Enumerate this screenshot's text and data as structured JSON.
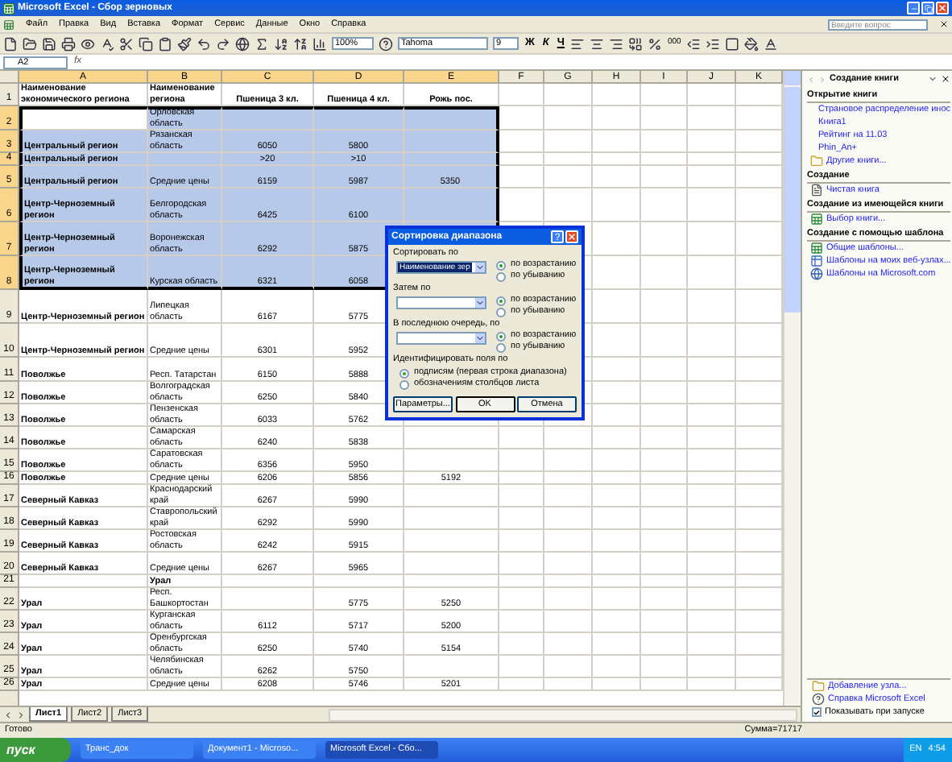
{
  "window": {
    "title": "Microsoft Excel - Сбор зерновых"
  },
  "menu": [
    "Файл",
    "Правка",
    "Вид",
    "Вставка",
    "Формат",
    "Сервис",
    "Данные",
    "Окно",
    "Справка"
  ],
  "help_search": {
    "placeholder": "Введите вопрос"
  },
  "toolbar": {
    "zoom": "100%",
    "font": "Tahoma",
    "size": "9",
    "format_buttons": [
      "Ж",
      "К",
      "Ч"
    ],
    "thousands": "000"
  },
  "formula_bar": {
    "name_box": "A2",
    "fx": "fx"
  },
  "columns": [
    {
      "label": "A",
      "selected": true
    },
    {
      "label": "B",
      "selected": true
    },
    {
      "label": "C",
      "selected": true
    },
    {
      "label": "D",
      "selected": true
    },
    {
      "label": "E",
      "selected": true
    },
    {
      "label": "F",
      "selected": false
    },
    {
      "label": "G",
      "selected": false
    },
    {
      "label": "H",
      "selected": false
    },
    {
      "label": "I",
      "selected": false
    },
    {
      "label": "J",
      "selected": false
    },
    {
      "label": "K",
      "selected": false
    }
  ],
  "rows": [
    {
      "n": "1",
      "kind": "header",
      "selected": false,
      "a": "Наименование экономического региона",
      "b": "Наименование региона",
      "c": "Пшеница 3 кл.",
      "d": "Пшеница 4 кл.",
      "e": "Рожь пос."
    },
    {
      "n": "2",
      "kind": "data",
      "selected": true,
      "b": "Орловская область"
    },
    {
      "n": "3",
      "kind": "data",
      "selected": true,
      "a": "Центральный регион",
      "b": "Рязанская область",
      "c": "6050",
      "d": "5800"
    },
    {
      "n": "4",
      "kind": "data",
      "selected": true,
      "a": "Центральный регион",
      "c": ">20",
      "d": ">10"
    },
    {
      "n": "5",
      "kind": "data",
      "selected": true,
      "a": "Центральный регион",
      "b": "Средние цены",
      "c": "6159",
      "d": "5987",
      "e": "5350"
    },
    {
      "n": "6",
      "kind": "data",
      "selected": true,
      "a": "Центр-Черноземный регион",
      "b": "Белгородская область",
      "c": "6425",
      "d": "6100"
    },
    {
      "n": "7",
      "kind": "data",
      "selected": true,
      "a": "Центр-Черноземный регион",
      "b": "Воронежская область",
      "c": "6292",
      "d": "5875"
    },
    {
      "n": "8",
      "kind": "data",
      "selected": true,
      "a": "Центр-Черноземный регион",
      "b": "Курская область",
      "c": "6321",
      "d": "6058"
    },
    {
      "n": "9",
      "kind": "data",
      "selected": false,
      "a": "Центр-Черноземный регион",
      "b": "Липецкая область",
      "c": "6167",
      "d": "5775"
    },
    {
      "n": "10",
      "kind": "data",
      "selected": false,
      "a": "Центр-Черноземный регион",
      "b": "Средние цены",
      "c": "6301",
      "d": "5952"
    },
    {
      "n": "11",
      "kind": "data",
      "selected": false,
      "a": "Поволжье",
      "b": "Респ. Татарстан",
      "c": "6150",
      "d": "5888"
    },
    {
      "n": "12",
      "kind": "data",
      "selected": false,
      "a": "Поволжье",
      "b": "Волгоградская область",
      "c": "6250",
      "d": "5840"
    },
    {
      "n": "13",
      "kind": "data",
      "selected": false,
      "a": "Поволжье",
      "b": "Пензенская область",
      "c": "6033",
      "d": "5762"
    },
    {
      "n": "14",
      "kind": "data",
      "selected": false,
      "a": "Поволжье",
      "b": "Самарская область",
      "c": "6240",
      "d": "5838"
    },
    {
      "n": "15",
      "kind": "data",
      "selected": false,
      "a": "Поволжье",
      "b": "Саратовская область",
      "c": "6356",
      "d": "5950"
    },
    {
      "n": "16",
      "kind": "data",
      "selected": false,
      "a": "Поволжье",
      "b": "Средние цены",
      "c": "6206",
      "d": "5856",
      "e": "5192"
    },
    {
      "n": "17",
      "kind": "data",
      "selected": false,
      "a": "Северный Кавказ",
      "b": "Краснодарский край",
      "c": "6267",
      "d": "5990"
    },
    {
      "n": "18",
      "kind": "data",
      "selected": false,
      "a": "Северный Кавказ",
      "b": "Ставропольский край",
      "c": "6292",
      "d": "5990"
    },
    {
      "n": "19",
      "kind": "data",
      "selected": false,
      "a": "Северный Кавказ",
      "b": "Ростовская область",
      "c": "6242",
      "d": "5915"
    },
    {
      "n": "20",
      "kind": "data",
      "selected": false,
      "a": "Северный Кавказ",
      "b": "Средние цены",
      "c": "6267",
      "d": "5965"
    },
    {
      "n": "21",
      "kind": "subheading",
      "selected": false,
      "b": "Урал"
    },
    {
      "n": "22",
      "kind": "data",
      "selected": false,
      "a": "Урал",
      "b": "Респ. Башкортостан",
      "d": "5775",
      "e": "5250"
    },
    {
      "n": "23",
      "kind": "data",
      "selected": false,
      "a": "Урал",
      "b": "Курганская область",
      "c": "6112",
      "d": "5717",
      "e": "5200"
    },
    {
      "n": "24",
      "kind": "data",
      "selected": false,
      "a": "Урал",
      "b": "Оренбургская область",
      "c": "6250",
      "d": "5740",
      "e": "5154"
    },
    {
      "n": "25",
      "kind": "data",
      "selected": false,
      "a": "Урал",
      "b": "Челябинская область",
      "c": "6262",
      "d": "5750"
    },
    {
      "n": "26",
      "kind": "data",
      "selected": false,
      "a": "Урал",
      "b": "Средние цены",
      "c": "6208",
      "d": "5746",
      "e": "5201"
    }
  ],
  "sheet_tabs": [
    {
      "label": "Лист1",
      "selected": true
    },
    {
      "label": "Лист2",
      "selected": false
    },
    {
      "label": "Лист3",
      "selected": false
    }
  ],
  "status_bar": {
    "state": "Готово",
    "sum": "Сумма=71717"
  },
  "dialog": {
    "title": "Сортировка диапазона",
    "help": "?",
    "sort_levels": [
      {
        "label": "Сортировать по",
        "value": "Наименование зер",
        "options": [
          {
            "label": "по возрастанию",
            "selected": true
          },
          {
            "label": "по убыванию",
            "selected": false
          }
        ]
      },
      {
        "label": "Затем по",
        "options": [
          {
            "label": "по возрастанию",
            "selected": true
          },
          {
            "label": "по убыванию",
            "selected": false
          }
        ]
      },
      {
        "label": "В последнюю очередь, по",
        "options": [
          {
            "label": "по возрастанию",
            "selected": true
          },
          {
            "label": "по убыванию",
            "selected": false
          }
        ]
      }
    ],
    "identify": {
      "label": "Идентифицировать поля по",
      "options": [
        {
          "label": "подписям (первая строка диапазона)",
          "selected": true
        },
        {
          "label": "обозначениям столбцов листа",
          "selected": false
        }
      ]
    },
    "buttons": [
      "Параметры...",
      "OK",
      "Отмена"
    ]
  },
  "task_pane": {
    "title": "Создание книги",
    "sections": [
      {
        "title": "Открытие книги",
        "items": [
          {
            "kind": "plain",
            "label": "Страновое распределение инос"
          },
          {
            "kind": "plain",
            "label": "Книга1"
          },
          {
            "kind": "plain",
            "label": "Рейтинг на 11.03"
          },
          {
            "kind": "plain",
            "label": "Phin_An+"
          },
          {
            "kind": "folder",
            "label": "Другие книги..."
          }
        ]
      },
      {
        "title": "Создание",
        "items": [
          {
            "kind": "page",
            "label": "Чистая книга"
          }
        ]
      },
      {
        "title": "Создание из имеющейся книги",
        "items": [
          {
            "kind": "sheet",
            "label": "Выбор книги..."
          }
        ]
      },
      {
        "title": "Создание с помощью шаблона",
        "items": [
          {
            "kind": "sheet",
            "label": "Общие шаблоны..."
          },
          {
            "kind": "web",
            "label": "Шаблоны на моих веб-узлах..."
          },
          {
            "kind": "globe",
            "label": "Шаблоны на Microsoft.com"
          }
        ]
      }
    ],
    "footer": [
      {
        "kind": "folder",
        "label": "Добавление узла..."
      },
      {
        "kind": "help",
        "label": "Справка Microsoft Excel"
      }
    ],
    "show_on_start": {
      "label": "Показывать при запуске",
      "checked": true
    }
  },
  "taskbar": {
    "start": "пуск",
    "tasks": [
      {
        "label": "Транс_док",
        "selected": false
      },
      {
        "label": "Документ1 - Microso...",
        "selected": false
      },
      {
        "label": "Microsoft Excel - Сбо...",
        "selected": true
      }
    ],
    "language": "EN",
    "clock": "4:54"
  }
}
